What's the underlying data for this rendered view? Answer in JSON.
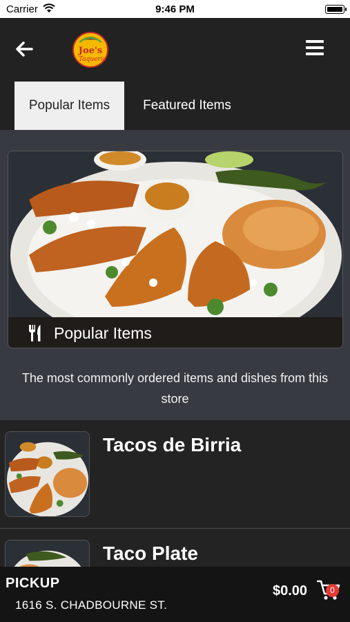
{
  "status_bar": {
    "carrier": "Carrier",
    "time": "9:46 PM"
  },
  "header": {
    "logo_text_line1": "Joe's",
    "logo_text_line2": "Taqueria"
  },
  "tabs": [
    {
      "label": "Popular Items",
      "active": true
    },
    {
      "label": "Featured Items",
      "active": false
    }
  ],
  "hero": {
    "title": "Popular Items",
    "description": "The most commonly ordered items and dishes from this store"
  },
  "items": [
    {
      "name": "Tacos de Birria"
    },
    {
      "name": "Taco Plate"
    }
  ],
  "footer": {
    "pickup_label": "PICKUP",
    "address": "1616 S. CHADBOURNE ST.",
    "cart_total": "$0.00",
    "cart_count": "0"
  },
  "colors": {
    "accent": "#e53935",
    "header_bg": "#222222",
    "content_bg": "#373a40"
  },
  "icons": [
    "back-arrow-icon",
    "menu-icon",
    "fork-knife-icon",
    "cart-icon",
    "wifi-icon",
    "battery-icon"
  ]
}
